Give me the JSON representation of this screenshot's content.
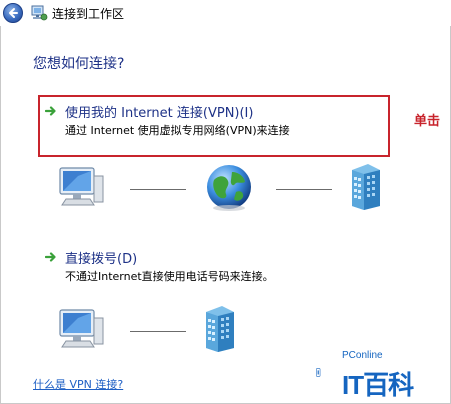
{
  "window": {
    "title": "连接到工作区",
    "back_icon": "back-arrow-icon",
    "app_icon": "network-icon"
  },
  "heading": "您想如何连接?",
  "options": [
    {
      "title": "使用我的 Internet 连接(VPN)(I)",
      "description": "通过 Internet 使用虚拟专用网络(VPN)来连接",
      "icon": "green-arrow-icon",
      "highlighted": true
    },
    {
      "title": "直接拨号(D)",
      "description": "不通过Internet直接使用电话号码来连接。",
      "icon": "green-arrow-icon",
      "highlighted": false
    }
  ],
  "annotation": "单击",
  "help_link": "什么是 VPN 连接?",
  "watermark": {
    "sub": "PConline",
    "main": "IT百科"
  },
  "colors": {
    "heading": "#1e3287",
    "highlight": "#c8242c",
    "link": "#1e5fc4",
    "arrow": "#3aa13a"
  }
}
